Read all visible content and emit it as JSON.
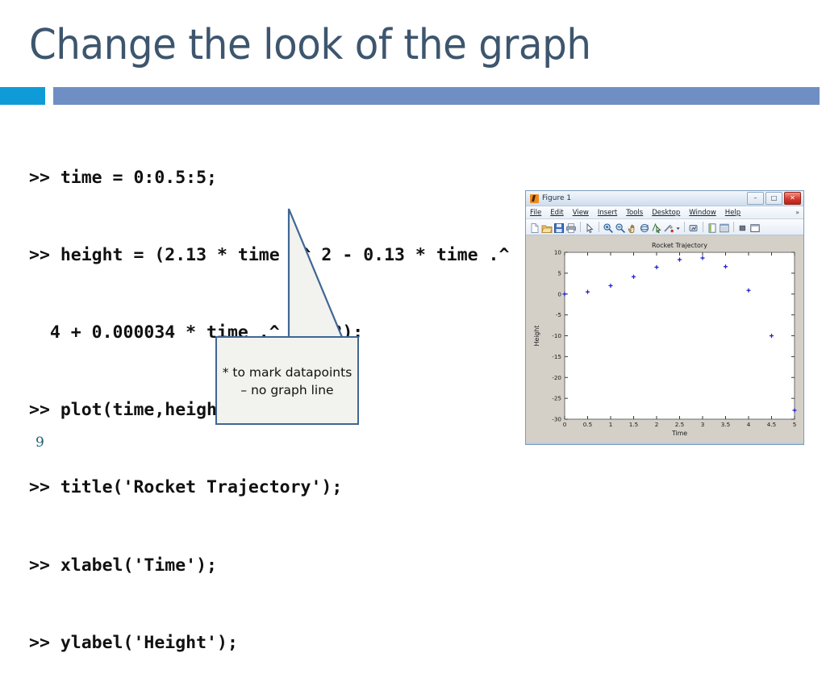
{
  "slide": {
    "title": "Change the look of the graph",
    "page_number": "9",
    "accent_color_primary": "#0f9bd7",
    "accent_color_secondary": "#6f8fc4",
    "title_color": "#3d566e"
  },
  "code": {
    "lines": [
      ">> time = 0:0.5:5;",
      ">> height = (2.13 * time .^ 2 - 0.13 * time .^",
      "  4 + 0.000034 * time .^ 4.752);",
      ">> title('Rocket Trajectory');",
      ">> xlabel('Time');",
      ">> ylabel('Height');"
    ],
    "plot_line_prefix": ">> plot(time,height,’",
    "plot_line_marker": "*",
    "plot_line_suffix": "’);",
    "marker_color": "#e8221c"
  },
  "callout": {
    "line1": "* to mark datapoints",
    "line2": "– no graph line",
    "border_color": "#3f6694",
    "fill_color": "#f2f2ee"
  },
  "figure_window": {
    "title": "Figure 1",
    "app_icon": "matlab-icon",
    "controls": [
      {
        "name": "minimize-button",
        "glyph": "–"
      },
      {
        "name": "maximize-button",
        "glyph": "□"
      },
      {
        "name": "close-button",
        "glyph": "✕"
      }
    ],
    "menu": [
      {
        "label": "File",
        "mnemonic": "F"
      },
      {
        "label": "Edit",
        "mnemonic": "E"
      },
      {
        "label": "View",
        "mnemonic": "V"
      },
      {
        "label": "Insert",
        "mnemonic": "I"
      },
      {
        "label": "Tools",
        "mnemonic": "T"
      },
      {
        "label": "Desktop",
        "mnemonic": "D"
      },
      {
        "label": "Window",
        "mnemonic": "W"
      },
      {
        "label": "Help",
        "mnemonic": "H"
      }
    ],
    "menu_overflow": "»",
    "toolbar": [
      "new-figure-icon",
      "open-file-icon",
      "save-figure-icon",
      "print-figure-icon",
      "separator",
      "pointer-icon",
      "separator",
      "zoom-in-icon",
      "zoom-out-icon",
      "pan-icon",
      "rotate-3d-icon",
      "data-cursor-icon",
      "brush-icon",
      "brush-dropdown-icon",
      "separator",
      "link-plot-icon",
      "separator",
      "figure-palette-icon",
      "plot-browser-icon",
      "separator",
      "property-editor-icon",
      "dock-figure-icon"
    ]
  },
  "chart_data": {
    "type": "scatter",
    "title": "Rocket Trajectory",
    "xlabel": "Time",
    "ylabel": "Height",
    "marker": "*",
    "marker_color": "#2222cc",
    "grid": false,
    "legend": null,
    "x": [
      0,
      0.5,
      1,
      1.5,
      2,
      2.5,
      3,
      3.5,
      4,
      4.5,
      5
    ],
    "y": [
      0,
      0.52,
      2.0,
      4.14,
      6.44,
      8.25,
      8.64,
      6.58,
      0.88,
      -10.01,
      -27.87
    ],
    "xlim": [
      0,
      5
    ],
    "ylim": [
      -30,
      10
    ],
    "xticks": [
      0,
      0.5,
      1,
      1.5,
      2,
      2.5,
      3,
      3.5,
      4,
      4.5,
      5
    ],
    "xticklabels": [
      "0",
      "0.5",
      "1",
      "1.5",
      "2",
      "2.5",
      "3",
      "3.5",
      "4",
      "4.5",
      "5"
    ],
    "yticks": [
      10,
      5,
      0,
      -5,
      -10,
      -15,
      -20,
      -25,
      -30
    ],
    "yticklabels": [
      "10",
      "5",
      "0",
      "-5",
      "-10",
      "-15",
      "-20",
      "-25",
      "-30"
    ]
  }
}
